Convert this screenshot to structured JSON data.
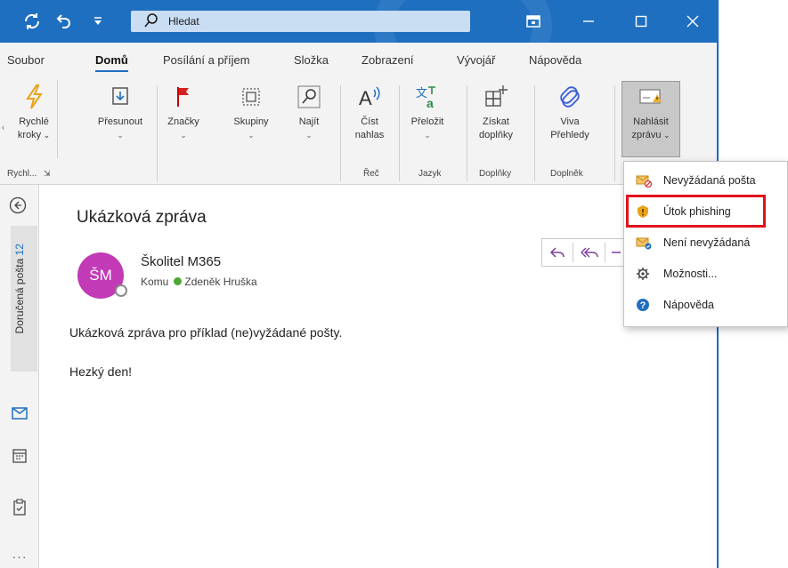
{
  "titlebar": {
    "search_placeholder": "Hledat",
    "icons": [
      "sync-icon",
      "undo-icon",
      "quick-access-dropdown-icon",
      "search-icon",
      "window-mode-icon",
      "minimize-icon",
      "maximize-icon",
      "close-icon"
    ]
  },
  "menu_tabs": [
    {
      "label": "Soubor"
    },
    {
      "label": "Domů"
    },
    {
      "label": "Posílání a příjem"
    },
    {
      "label": "Složka"
    },
    {
      "label": "Zobrazení"
    },
    {
      "label": "Vývojář"
    },
    {
      "label": "Nápověda"
    }
  ],
  "active_tab": "Domů",
  "ribbon": {
    "quick_steps": {
      "line1": "Rychlé",
      "line2": "kroky"
    },
    "move": {
      "label": "Přesunout"
    },
    "tags": {
      "label": "Značky"
    },
    "groups": {
      "label": "Skupiny"
    },
    "find": {
      "label": "Najít"
    },
    "read_aloud": {
      "line1": "Číst",
      "line2": "nahlas"
    },
    "translate": {
      "label": "Přeložit"
    },
    "get_addins": {
      "line1": "Získat",
      "line2": "doplňky"
    },
    "viva": {
      "line1": "Viva",
      "line2": "Přehledy"
    },
    "report": {
      "line1": "Nahlásit",
      "line2": "zprávu"
    },
    "group_labels": {
      "quick": "Rychl...",
      "speech": "Řeč",
      "language": "Jazyk",
      "addins": "Doplňky",
      "addin": "Doplněk"
    }
  },
  "leftnav": {
    "inbox_label": "Doručená pošta",
    "inbox_count": "12"
  },
  "message": {
    "subject": "Ukázková zpráva",
    "avatar_initials": "ŠM",
    "sender": "Školitel M365",
    "to_label": "Komu",
    "recipient": "Zdeněk Hruška",
    "body_line1": "Ukázková zpráva pro příklad (ne)vyžádané pošty.",
    "body_line2": "Hezký den!"
  },
  "report_menu": [
    {
      "label": "Nevyžádaná pošta",
      "icon": "junk-mail-icon"
    },
    {
      "label": "Útok phishing",
      "icon": "phishing-warning-icon"
    },
    {
      "label": "Není nevyžádaná",
      "icon": "not-junk-icon"
    },
    {
      "label": "Možnosti...",
      "icon": "gear-icon"
    },
    {
      "label": "Nápověda",
      "icon": "help-icon"
    }
  ],
  "highlighted_item": "Útok phishing",
  "colors": {
    "accent": "#1f6fc0",
    "avatar": "#c23ab6",
    "highlight": "#e0121b",
    "presence": "#4ca734"
  }
}
